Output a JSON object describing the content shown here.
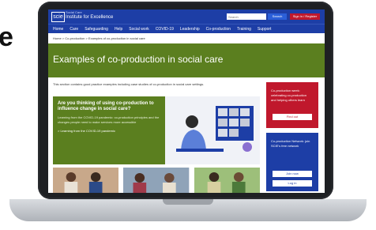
{
  "overlay": {
    "side_letter": "e"
  },
  "site": {
    "logo_text": "scie",
    "brand_small": "Social Care",
    "brand": "Institute for Excellence",
    "search_placeholder": "Search",
    "search_button": "Search",
    "signin_button": "Sign in / Register"
  },
  "nav": [
    "Home",
    "Care",
    "Safeguarding",
    "Help",
    "Social work",
    "COVID-19",
    "Leadership",
    "Co-production",
    "Training",
    "Support"
  ],
  "breadcrumb": "Home > Co-production > Examples of co-production in social care",
  "hero": {
    "title": "Examples of co-production in social care"
  },
  "intro": "This section contains good practice examples including case studies of co-production in social care settings.",
  "feature": {
    "title": "Are you thinking of using co-production to influence change in social care?",
    "body": "Learning from the COVID-19 pandemic: co-production principles and the changes people need to make services more accessible",
    "link": "> Learning from the COVID-19 pandemic"
  },
  "sidebar": {
    "red_text": "Co-production week: celebrating co-production and helping others learn",
    "red_button": "Find out",
    "blue_text": "Co-production Network: join SCIE's free network",
    "blue_button_1": "Join now",
    "blue_button_2": "Log in"
  },
  "colors": {
    "brand_blue": "#1d3ea6",
    "hero_green": "#5b7f1f",
    "accent_red": "#c0182c",
    "laptop_body": "#1e2023"
  }
}
